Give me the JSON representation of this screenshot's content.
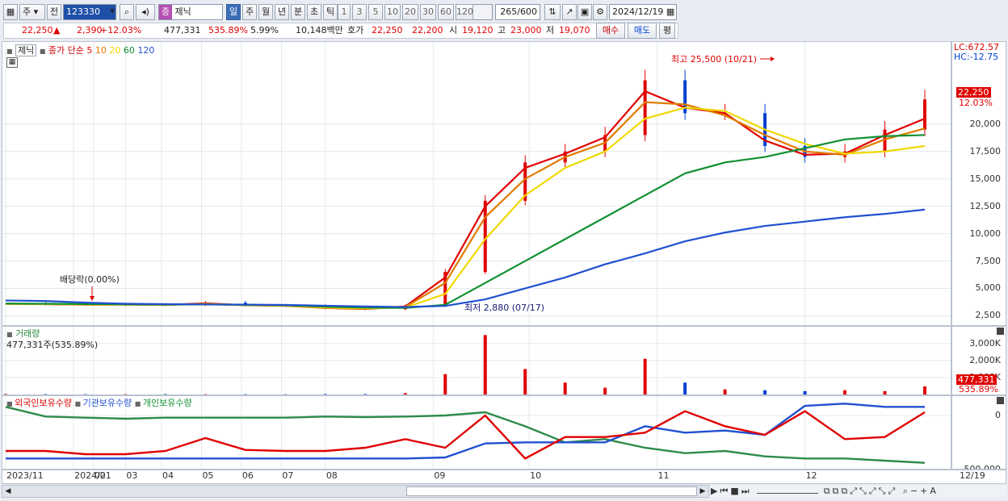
{
  "toolbar": {
    "market": "주",
    "prev": "전",
    "code": "123330",
    "name": "제닉",
    "stock_badge": "증",
    "periods": [
      "일",
      "주",
      "월",
      "년",
      "분",
      "초",
      "틱"
    ],
    "active_period": "일",
    "intervals": [
      "1",
      "3",
      "5",
      "10",
      "20",
      "30",
      "60",
      "120"
    ],
    "count": "265",
    "count_max": "/600",
    "date": "2024/12/19"
  },
  "quote": {
    "price": "22,250",
    "arrow": "▲",
    "change": "2,390",
    "change_pct": "+12.03%",
    "volume": "477,331",
    "vol_pct": "535.89%",
    "turnover": "5.99%",
    "amount": "10,148백만",
    "ask_label": "호가",
    "ask": "22,250",
    "bid": "22,200",
    "open_label": "시",
    "open": "19,120",
    "high_label": "고",
    "high": "23,000",
    "low_label": "저",
    "low": "19,070",
    "buy": "매수",
    "sell": "매도",
    "avg": "평"
  },
  "price_panel": {
    "title": "제닉",
    "ma_label": "종가 단순",
    "ma_periods": [
      "5",
      "10",
      "20",
      "60",
      "120"
    ],
    "ma_colors": [
      "#e00000",
      "#e07a00",
      "#f0d800",
      "#119030",
      "#2050d0"
    ],
    "lc": "LC:672.57",
    "hc": "HC:-12.75",
    "high_note": "최고 25,500 (10/21)",
    "low_note": "최저 2,880 (07/17)",
    "dividend_note": "배당락(0.00%)",
    "last_price": "22,250",
    "last_pct": "12.03%",
    "y_ticks": [
      "20,000",
      "17,500",
      "15,000",
      "12,500",
      "10,000",
      "7,500",
      "5,000",
      "2,500"
    ]
  },
  "volume_panel": {
    "title": "거래량",
    "value": "477,331주(535.89%)",
    "y_ticks": [
      "3,000K",
      "2,000K",
      "1,000K"
    ],
    "last_value": "477,331",
    "last_pct": "535.89%"
  },
  "holdings_panel": {
    "legend": [
      {
        "label": "외국인보유수량",
        "color": "#e00000"
      },
      {
        "label": "기관보유수량",
        "color": "#2050d0"
      },
      {
        "label": "개인보유수량",
        "color": "#119030"
      }
    ],
    "y_ticks": [
      "0",
      "-500,000"
    ]
  },
  "x_axis": {
    "labels": [
      "2023/11",
      "2024/01",
      "02",
      "03",
      "04",
      "05",
      "06",
      "07",
      "08",
      "09",
      "10",
      "11",
      "12"
    ],
    "last_date": "12/19"
  },
  "chart_data": {
    "type": "line",
    "title": "제닉",
    "ylabel": "",
    "ylim": [
      1500,
      27500
    ],
    "x_dates": [
      "2023/11",
      "2023/12",
      "2024/01",
      "2024/02",
      "2024/03",
      "2024/04",
      "2024/05",
      "2024/06",
      "2024/07",
      "2024/08",
      "2024/08/20",
      "2024/09",
      "2024/09/10",
      "2024/09/20",
      "2024/10",
      "2024/10/10",
      "2024/10/21",
      "2024/10/31",
      "2024/11",
      "2024/11/15",
      "2024/11/25",
      "2024/12",
      "2024/12/10",
      "2024/12/19"
    ],
    "series": [
      {
        "name": "종가",
        "values": [
          3600,
          3550,
          3500,
          3520,
          3480,
          3700,
          3450,
          3400,
          3200,
          3100,
          3400,
          6500,
          13000,
          16500,
          17500,
          19000,
          24000,
          21000,
          21000,
          18000,
          17000,
          17500,
          19500,
          22250
        ]
      },
      {
        "name": "5",
        "values": [
          3600,
          3560,
          3510,
          3520,
          3490,
          3650,
          3460,
          3410,
          3210,
          3120,
          3350,
          6000,
          12500,
          16000,
          17300,
          18800,
          23000,
          21500,
          21000,
          18500,
          17200,
          17300,
          19000,
          20500
        ]
      },
      {
        "name": "10",
        "values": [
          3600,
          3570,
          3520,
          3520,
          3500,
          3600,
          3470,
          3420,
          3230,
          3140,
          3300,
          5500,
          11500,
          15000,
          17000,
          18300,
          22000,
          21800,
          20800,
          19000,
          17500,
          17200,
          18600,
          19600
        ]
      },
      {
        "name": "20",
        "values": [
          3600,
          3580,
          3540,
          3520,
          3510,
          3560,
          3480,
          3430,
          3260,
          3180,
          3250,
          4500,
          9500,
          13500,
          16000,
          17500,
          20500,
          21500,
          21200,
          19500,
          18200,
          17300,
          17500,
          18000
        ]
      },
      {
        "name": "60",
        "values": [
          3620,
          3600,
          3570,
          3540,
          3520,
          3530,
          3500,
          3460,
          3330,
          3250,
          3220,
          3500,
          5500,
          7500,
          9500,
          11500,
          13500,
          15500,
          16500,
          17000,
          17800,
          18600,
          18900,
          19000
        ]
      },
      {
        "name": "120",
        "values": [
          3900,
          3850,
          3700,
          3600,
          3560,
          3540,
          3520,
          3490,
          3420,
          3350,
          3300,
          3400,
          4000,
          5000,
          6000,
          7200,
          8200,
          9300,
          10100,
          10700,
          11100,
          11500,
          11800,
          12200
        ]
      }
    ],
    "volume_k": [
      30,
      25,
      20,
      20,
      25,
      20,
      20,
      15,
      30,
      30,
      80,
      1200,
      3500,
      1500,
      700,
      400,
      2100,
      700,
      300,
      250,
      200,
      250,
      200,
      477
    ],
    "holdings": {
      "foreign": [
        -330000,
        -330000,
        -360000,
        -360000,
        -330000,
        -210000,
        -320000,
        -330000,
        -330000,
        -300000,
        -220000,
        -300000,
        0,
        -400000,
        -200000,
        -200000,
        -160000,
        40000,
        -100000,
        -180000,
        40000,
        -220000,
        -200000,
        30000
      ],
      "institution": [
        -400000,
        -400000,
        -400000,
        -400000,
        -400000,
        -400000,
        -400000,
        -400000,
        -400000,
        -400000,
        -400000,
        -390000,
        -260000,
        -250000,
        -250000,
        -250000,
        -100000,
        -160000,
        -140000,
        -180000,
        90000,
        110000,
        80000,
        80000
      ],
      "individual": [
        80000,
        -10000,
        -20000,
        -30000,
        -20000,
        -20000,
        -20000,
        -20000,
        -10000,
        -15000,
        -10000,
        0,
        30000,
        -100000,
        -250000,
        -220000,
        -300000,
        -350000,
        -330000,
        -380000,
        -400000,
        -400000,
        -420000,
        -440000
      ]
    }
  }
}
